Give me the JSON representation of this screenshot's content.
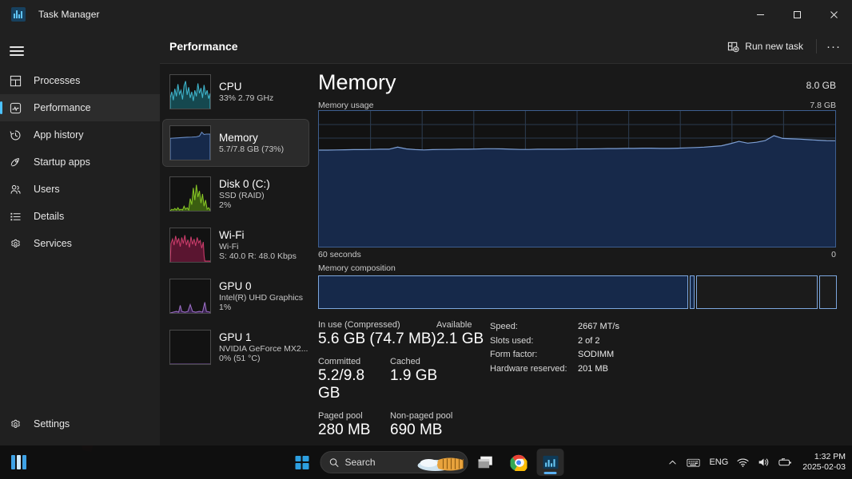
{
  "window": {
    "title": "Task Manager",
    "app_icon": "task-manager-icon",
    "minimize": "–",
    "maximize": "□",
    "close": "✕"
  },
  "nav": {
    "hamburger": "menu-icon",
    "items": [
      {
        "label": "Processes",
        "icon": "processes-icon",
        "selected": false
      },
      {
        "label": "Performance",
        "icon": "performance-icon",
        "selected": true
      },
      {
        "label": "App history",
        "icon": "history-icon",
        "selected": false
      },
      {
        "label": "Startup apps",
        "icon": "rocket-icon",
        "selected": false
      },
      {
        "label": "Users",
        "icon": "users-icon",
        "selected": false
      },
      {
        "label": "Details",
        "icon": "details-icon",
        "selected": false
      },
      {
        "label": "Services",
        "icon": "services-icon",
        "selected": false
      }
    ],
    "settings": {
      "label": "Settings",
      "icon": "gear-icon"
    }
  },
  "header": {
    "title": "Performance",
    "run_new_task": "Run new task",
    "run_new_task_icon": "run-task-icon",
    "more_options": "···"
  },
  "resources": [
    {
      "name": "CPU",
      "line1": "33%  2.79 GHz",
      "line2": "",
      "color": "#3fb5cc",
      "selected": false
    },
    {
      "name": "Memory",
      "line1": "5.7/7.8 GB (73%)",
      "line2": "",
      "color": "#3a6bb5",
      "selected": true
    },
    {
      "name": "Disk 0 (C:)",
      "line1": "SSD (RAID)",
      "line2": "2%",
      "color": "#86c425",
      "selected": false
    },
    {
      "name": "Wi-Fi",
      "line1": "Wi-Fi",
      "line2": "S: 40.0 R: 48.0 Kbps",
      "color": "#b4305c",
      "selected": false
    },
    {
      "name": "GPU 0",
      "line1": "Intel(R) UHD Graphics",
      "line2": "1%",
      "color": "#8a5fb0",
      "selected": false
    },
    {
      "name": "GPU 1",
      "line1": "NVIDIA GeForce MX2...",
      "line2": "0%  (51 °C)",
      "color": "#8a5fb0",
      "selected": false
    }
  ],
  "detail": {
    "title": "Memory",
    "total": "8.0 GB",
    "graph_caption": "Memory usage",
    "graph_max": "7.8 GB",
    "axis_left": "60 seconds",
    "axis_right": "0",
    "composition_caption": "Memory composition",
    "stats": {
      "in_use_label": "In use (Compressed)",
      "in_use_value": "5.6 GB (74.7 MB)",
      "available_label": "Available",
      "available_value": "2.1 GB",
      "committed_label": "Committed",
      "committed_value": "5.2/9.8 GB",
      "cached_label": "Cached",
      "cached_value": "1.9 GB",
      "paged_label": "Paged pool",
      "paged_value": "280 MB",
      "nonpaged_label": "Non-paged pool",
      "nonpaged_value": "690 MB"
    },
    "specs": [
      {
        "label": "Speed:",
        "value": "2667 MT/s"
      },
      {
        "label": "Slots used:",
        "value": "2 of 2"
      },
      {
        "label": "Form factor:",
        "value": "SODIMM"
      },
      {
        "label": "Hardware reserved:",
        "value": "201 MB"
      }
    ]
  },
  "chart_data": {
    "type": "area",
    "title": "Memory usage",
    "xlabel": "",
    "ylabel": "",
    "ylim": [
      0,
      7.8
    ],
    "xlim": [
      60,
      0
    ],
    "grid": true,
    "series": [
      {
        "name": "Memory in use (GB)",
        "values": [
          5.55,
          5.55,
          5.56,
          5.57,
          5.58,
          5.58,
          5.59,
          5.6,
          5.6,
          5.72,
          5.62,
          5.58,
          5.56,
          5.58,
          5.59,
          5.59,
          5.6,
          5.6,
          5.61,
          5.63,
          5.63,
          5.62,
          5.6,
          5.59,
          5.59,
          5.6,
          5.6,
          5.6,
          5.6,
          5.61,
          5.62,
          5.62,
          5.63,
          5.64,
          5.64,
          5.65,
          5.65,
          5.66,
          5.66,
          5.65,
          5.65,
          5.66,
          5.68,
          5.7,
          5.72,
          5.76,
          5.8,
          5.92,
          6.05,
          5.95,
          6.0,
          6.1,
          6.38,
          6.22,
          6.2,
          6.18,
          6.15,
          6.12,
          6.1,
          6.09
        ]
      }
    ],
    "axis_labels": {
      "left": "60 seconds",
      "right": "0",
      "max": "7.8 GB"
    }
  },
  "composition": {
    "segments": [
      {
        "name": "in-use",
        "width_pct": 71.5,
        "filled": true
      },
      {
        "name": "modified",
        "width_pct": 0.9,
        "filled": true
      },
      {
        "name": "standby",
        "width_pct": 23.5,
        "filled": false
      },
      {
        "name": "free",
        "width_pct": 3.3,
        "filled": false
      }
    ]
  },
  "taskbar": {
    "start": "start-icon",
    "search_placeholder": "Search",
    "items": [
      {
        "name": "file-explorer-icon",
        "active": false
      },
      {
        "name": "chrome-icon",
        "active": false
      },
      {
        "name": "task-manager-icon",
        "active": true
      }
    ],
    "tray": {
      "chevron": "chevron-up-icon",
      "keyboard": "keyboard-icon",
      "language": "ENG",
      "wifi": "wifi-icon",
      "volume": "volume-icon",
      "battery": "battery-icon",
      "time": "1:32 PM",
      "date": "2025-02-03"
    }
  }
}
